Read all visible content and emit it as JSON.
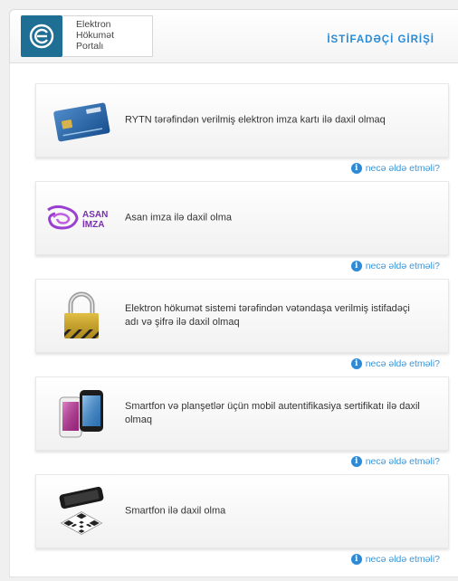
{
  "header": {
    "logo_lines": [
      "Elektron",
      "Hökumət",
      "Portalı"
    ],
    "login_title": "İSTİFADƏÇİ GİRİŞİ"
  },
  "asan_logo": {
    "line1": "ASAN",
    "line2": "İMZA"
  },
  "options": [
    {
      "label": "RYTN tərəfindən verilmiş elektron imza kartı ilə daxil olmaq",
      "icon": "id-card-icon",
      "help": "necə əldə etməli?"
    },
    {
      "label": "Asan imza ilə daxil olma",
      "icon": "asan-imza-logo-icon",
      "help": "necə əldə etməli?"
    },
    {
      "label": "Elektron hökumət sistemi tərəfindən vətəndaşa verilmiş istifadəçi adı və şifrə ilə daxil olmaq",
      "icon": "padlock-icon",
      "help": "necə əldə etməli?"
    },
    {
      "label": "Smartfon və planşetlər üçün mobil autentifikasiya sertifikatı ilə daxil olmaq",
      "icon": "smartphones-icon",
      "help": "necə əldə etməli?"
    },
    {
      "label": "Smartfon ilə daxil olma",
      "icon": "qr-code-phone-icon",
      "help": "necə əldə etməli?"
    }
  ],
  "colors": {
    "accent": "#2a8bd5",
    "link": "#3f95d8",
    "logo_tile": "#1f6f95",
    "asan": "#7a2fb0"
  }
}
